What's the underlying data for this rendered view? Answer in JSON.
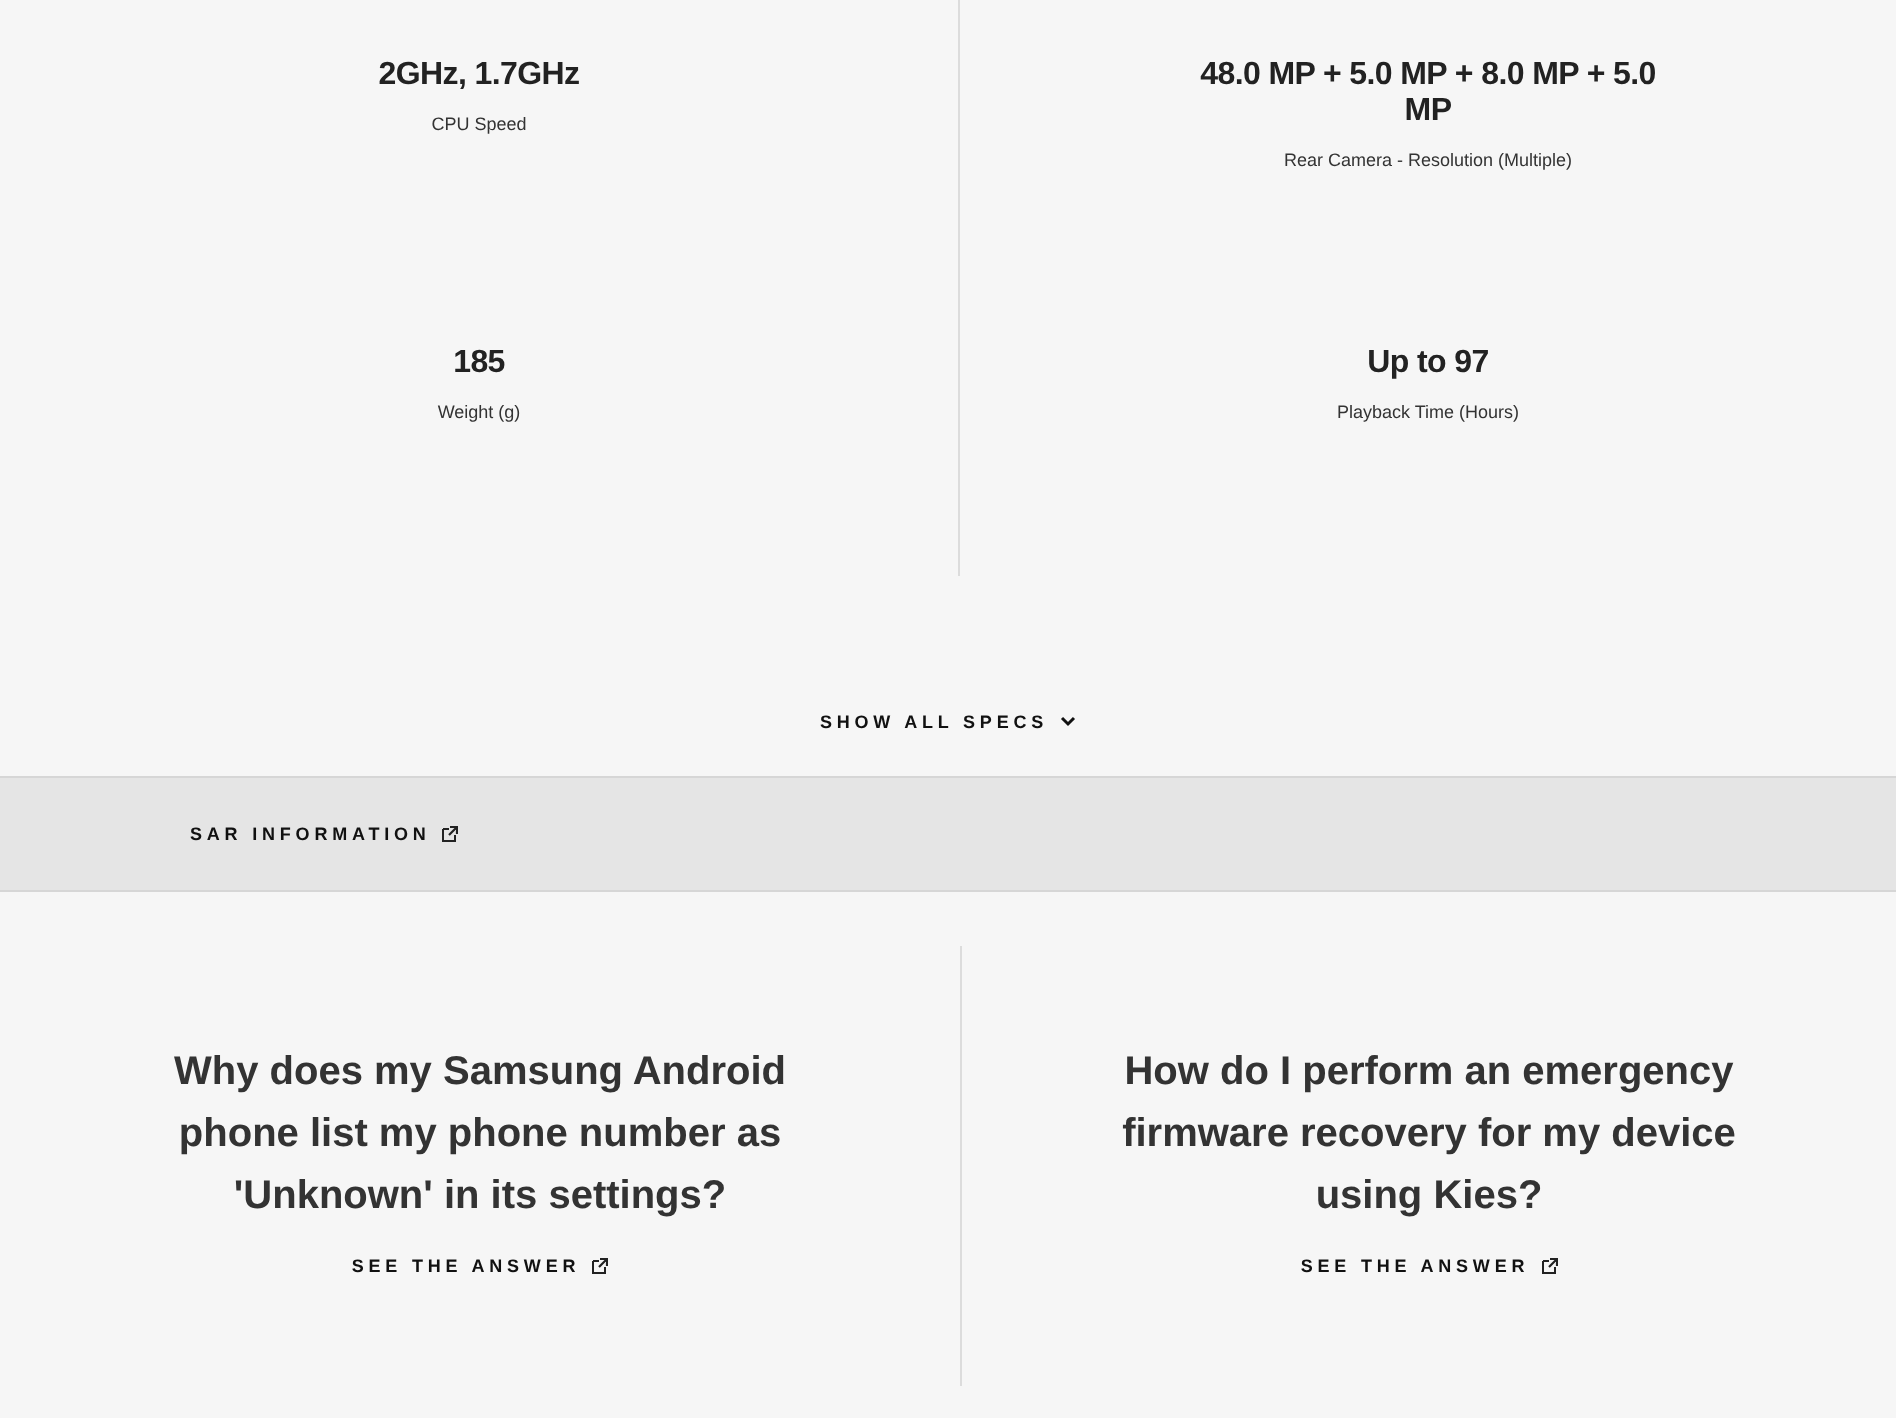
{
  "specs": [
    {
      "value": "2GHz, 1.7GHz",
      "label": "CPU Speed"
    },
    {
      "value": "48.0 MP + 5.0 MP + 8.0 MP + 5.0 MP",
      "label": "Rear Camera - Resolution (Multiple)"
    },
    {
      "value": "185",
      "label": "Weight (g)"
    },
    {
      "value": "Up to 97",
      "label": "Playback Time (Hours)"
    }
  ],
  "show_all_specs": {
    "label": "SHOW ALL SPECS"
  },
  "sar_link": {
    "label": "SAR INFORMATION"
  },
  "faqs": [
    {
      "question": "Why does my Samsung Android phone list my phone number as 'Unknown' in its settings?",
      "link": "SEE THE ANSWER"
    },
    {
      "question": "How do I perform an emergency firmware recovery for my device using Kies?",
      "link": "SEE THE ANSWER"
    }
  ]
}
